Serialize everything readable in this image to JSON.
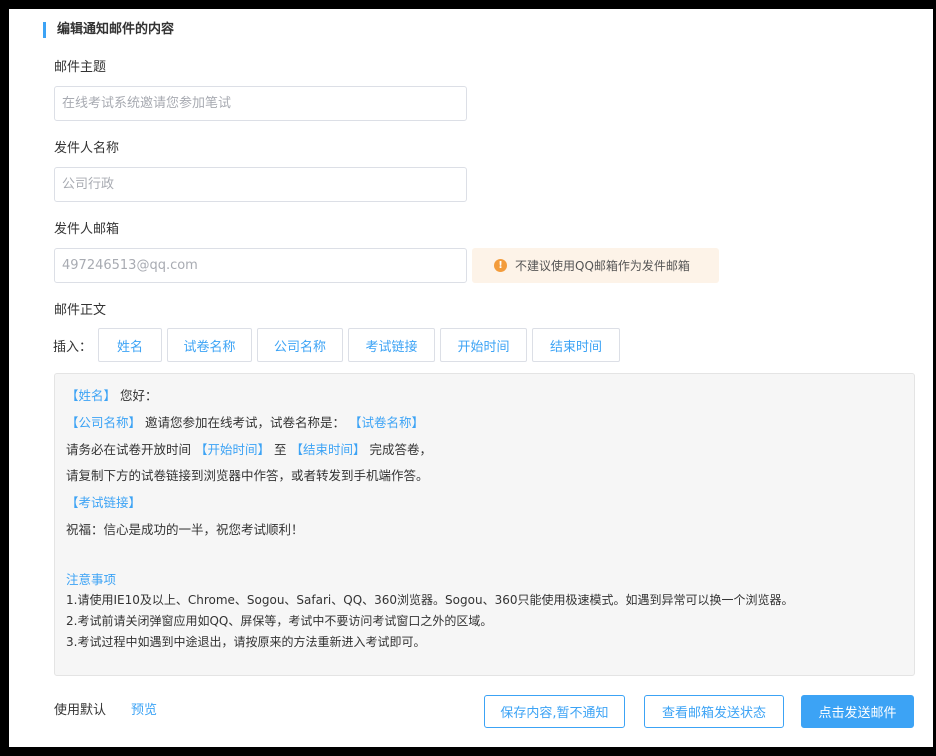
{
  "section_title": "编辑通知邮件的内容",
  "subject": {
    "label": "邮件主题",
    "placeholder": "在线考试系统邀请您参加笔试"
  },
  "sender_name": {
    "label": "发件人名称",
    "placeholder": "公司行政"
  },
  "sender_email": {
    "label": "发件人邮箱",
    "placeholder": "497246513@qq.com"
  },
  "warning": {
    "icon": "warning-icon",
    "text": "不建议使用QQ邮箱作为发件邮箱",
    "color": "#f39c3c"
  },
  "body": {
    "label": "邮件正文",
    "insert_label": "插入：",
    "insert_buttons": [
      "姓名",
      "试卷名称",
      "公司名称",
      "考试链接",
      "开始时间",
      "结束时间"
    ],
    "lines": {
      "l1_tag": "【姓名】",
      "l1_text": "您好：",
      "l2_tag1": "【公司名称】",
      "l2_text": "邀请您参加在线考试，试卷名称是：",
      "l2_tag2": "【试卷名称】",
      "l3_text1": "请务必在试卷开放时间",
      "l3_tag1": "【开始时间】",
      "l3_text2": "至",
      "l3_tag2": "【结束时间】",
      "l3_text3": "完成答卷，",
      "l4_text": "请复制下方的试卷链接到浏览器中作答，或者转发到手机端作答。",
      "l5_tag": "【考试链接】",
      "l6_text": "祝福：信心是成功的一半，祝您考试顺利！"
    },
    "notes_title": "注意事项",
    "notes": [
      "1.请使用IE10及以上、Chrome、Sogou、Safari、QQ、360浏览器。Sogou、360只能使用极速模式。如遇到异常可以换一个浏览器。",
      "2.考试前请关闭弹窗应用如QQ、屏保等，考试中不要访问考试窗口之外的区域。",
      "3.考试过程中如遇到中途退出，请按原来的方法重新进入考试即可。"
    ]
  },
  "footer": {
    "use_default": "使用默认",
    "preview": "预览",
    "save_button": "保存内容,暂不通知",
    "status_button": "查看邮箱发送状态",
    "send_button": "点击发送邮件"
  },
  "colors": {
    "accent": "#3ca3f5",
    "warning_bg": "#fdf3e8"
  }
}
